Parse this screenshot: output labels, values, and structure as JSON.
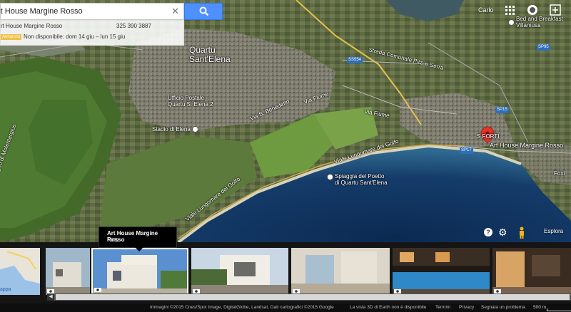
{
  "search": {
    "query": "rt House Margine Rosso",
    "clear_icon": "close-icon",
    "button_icon": "search-icon"
  },
  "result": {
    "title": "rt House Margine Rosso",
    "phone": "325 390 3887",
    "ad_badge": "Annuncio",
    "availability": "Non disponibile: dom 14 giu – lun 15 giu"
  },
  "topright": {
    "user": "Carlo",
    "apps_icon": "apps-grid-icon",
    "notifications_count": "",
    "share_icon": "share-icon"
  },
  "map": {
    "labels": {
      "city": "Quartu\nSant'Elena",
      "bnb": "Bed and Breakfast\nVillamusa",
      "postoffice": "Ufficio Postale -\nQuartu S. Elena 2",
      "stadium": "Stadio di Elena",
      "beach": "Spiaggia del Poetto\ndi Quartu Sant'Elena",
      "marker": "Art House Margine Rosso",
      "via_sbenedetto": "Via S. Benedetto",
      "via_fiume": "Via Fiume",
      "via_fiume2": "Via Fiume",
      "viale_golfo": "Viale Lungomare del Golfo",
      "lungomare2": "Viale Lungomare del Golfo",
      "strada": "Strada Comunale Pitz 'e Serra",
      "stagno": "Stagno di Molentargius",
      "sforti": "S FORTI",
      "foxi": "Foxi"
    },
    "badges": {
      "ss554": "SS554",
      "sp95": "SP95",
      "sp15": "SP15",
      "sp17": "SP17"
    }
  },
  "controls": {
    "help_icon": "help-icon",
    "settings_icon": "gear-icon",
    "pegman_icon": "pegman-icon",
    "explore": "Esplora"
  },
  "filmstrip": {
    "tooltip_title": "Art House Margine Rosso",
    "tooltip_sub": "FOTO",
    "mini_label": "appa"
  },
  "footer": {
    "attribution": "Immagini ©2015 Cnes/Spot Image, DigitalGlobe, Landsat, Dati cartografici ©2015 Google",
    "earth": "La vista 3D di Earth non è disponibile",
    "terms": "Termini",
    "privacy": "Privacy",
    "report": "Segnala un problema",
    "scale": "500 m"
  }
}
